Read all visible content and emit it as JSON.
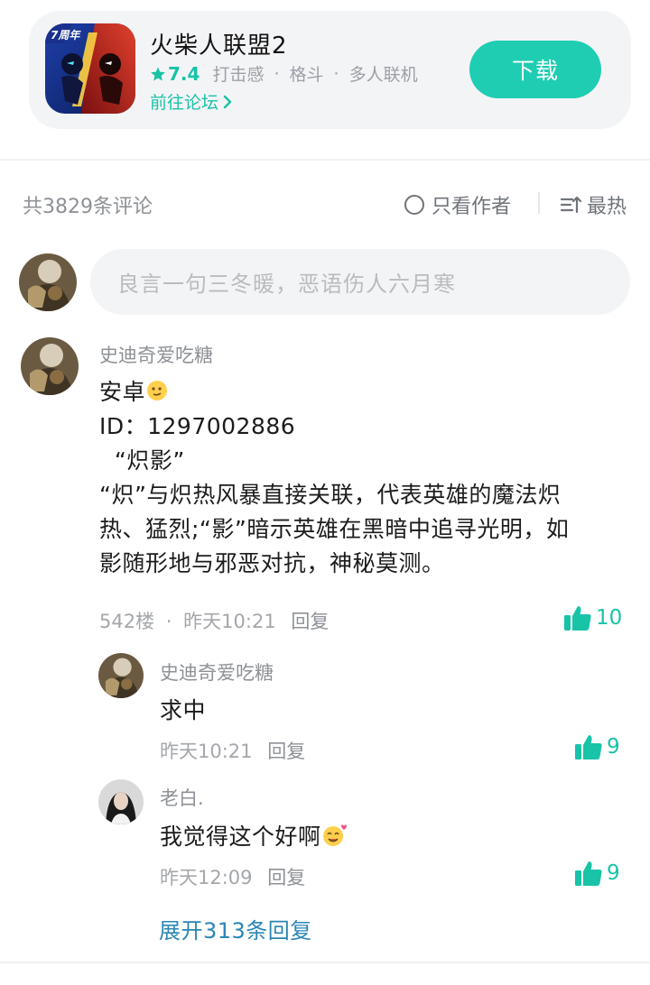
{
  "app": {
    "name": "火柴人联盟2",
    "rating": "7.4",
    "tags": [
      "打击感",
      "格斗",
      "多人联机"
    ],
    "forum_link": "前往论坛",
    "download_label": "下载",
    "icon_badge": "7周年",
    "accent_color": "#1fcdb2"
  },
  "toolbar": {
    "comment_count": "共3829条评论",
    "author_only": "只看作者",
    "sort": "最热"
  },
  "composer": {
    "placeholder": "良言一句三冬暖，恶语伤人六月寒"
  },
  "comment": {
    "username": "史迪奇爱吃糖",
    "lines": [
      "安卓",
      "ID：1297002886",
      "  “炽影”",
      "“炽”与炽热风暴直接关联，代表英雄的魔法炽",
      "热、猛烈;“影”暗示英雄在黑暗中追寻光明，如",
      "影随形地与邪恶对抗，神秘莫测。"
    ],
    "floor": "542楼",
    "time": "昨天10:21",
    "reply_label": "回复",
    "likes": "10",
    "replies": [
      {
        "username": "史迪奇爱吃糖",
        "text": "求中",
        "time": "昨天10:21",
        "reply_label": "回复",
        "likes": "9"
      },
      {
        "username": "老白.",
        "text": "我觉得这个好啊",
        "time": "昨天12:09",
        "reply_label": "回复",
        "likes": "9"
      }
    ],
    "expand_label": "展开313条回复"
  }
}
